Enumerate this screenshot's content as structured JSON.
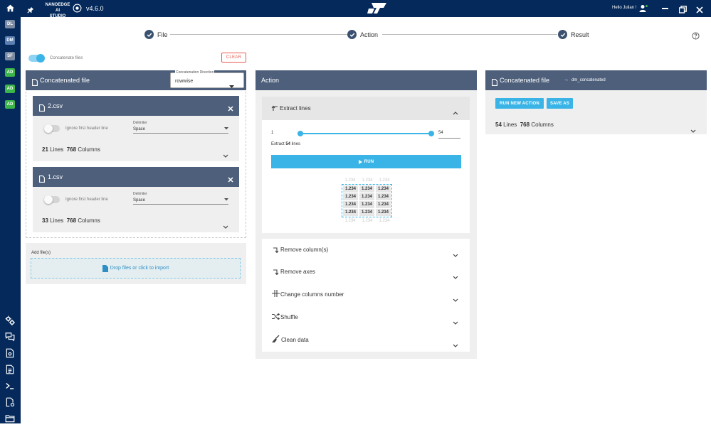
{
  "app": {
    "name_line1": "NANOEDGE AI",
    "name_line2": "STUDIO",
    "version": "v4.6.0",
    "greeting": "Hello Julian !",
    "brand_logo": "ST"
  },
  "sidebar": {
    "badges": [
      {
        "label": "DL",
        "color": "#7a8aa3"
      },
      {
        "label": "DM",
        "color": "#5b7fb0"
      },
      {
        "label": "SF",
        "color": "#7a8aa3"
      },
      {
        "label": "AD",
        "color": "#3bb54a"
      },
      {
        "label": "AD",
        "color": "#3bb54a"
      },
      {
        "label": "AD",
        "color": "#3bb54a"
      }
    ],
    "bottom_icons": [
      "settings-icon",
      "chat-icon",
      "document-gear-icon",
      "report-icon",
      "terminal-icon",
      "file-gear-icon",
      "folder-icon"
    ]
  },
  "stepper": {
    "steps": [
      "File",
      "Action",
      "Result"
    ]
  },
  "controls": {
    "concatenate_label": "Concatenate files",
    "clear_label": "CLEAR"
  },
  "left_panel": {
    "title": "Concatenated file",
    "direction_label": "Concatenation Direction",
    "direction_value": "rowwise",
    "files": [
      {
        "name": "2.csv",
        "ignore_header": "Ignore first header line",
        "delimiter_label": "Delimiter",
        "delimiter_value": "Space",
        "lines": "21",
        "lines_word": "Lines",
        "columns": "768",
        "columns_word": "Columns"
      },
      {
        "name": "1.csv",
        "ignore_header": "Ignore first header line",
        "delimiter_label": "Delimiter",
        "delimiter_value": "Space",
        "lines": "33",
        "lines_word": "Lines",
        "columns": "768",
        "columns_word": "Columns"
      }
    ],
    "add_files_label": "Add file(s)",
    "drop_label": "Drop files or click to import"
  },
  "action_panel": {
    "title": "Action",
    "extract": {
      "title": "Extract lines",
      "min": "1",
      "max": "54",
      "range_start": 0.0,
      "range_end": 1.0,
      "summary_prefix": "Extract",
      "summary_count": "54",
      "summary_suffix": "lines",
      "run_label": "RUN",
      "grid_value": "1.234"
    },
    "items": [
      {
        "label": "Remove column(s)",
        "icon": "remove-column-icon"
      },
      {
        "label": "Remove axes",
        "icon": "remove-axes-icon"
      },
      {
        "label": "Change columns number",
        "icon": "columns-icon"
      },
      {
        "label": "Shuffle",
        "icon": "shuffle-icon"
      },
      {
        "label": "Clean data",
        "icon": "broom-icon"
      }
    ]
  },
  "result_panel": {
    "title": "Concatenated file",
    "arrow": "→",
    "target": "dm_concatenated",
    "run_new_label": "RUN NEW ACTION",
    "save_as_label": "SAVE AS",
    "lines": "54",
    "lines_word": "Lines",
    "columns": "768",
    "columns_word": "Columns"
  }
}
